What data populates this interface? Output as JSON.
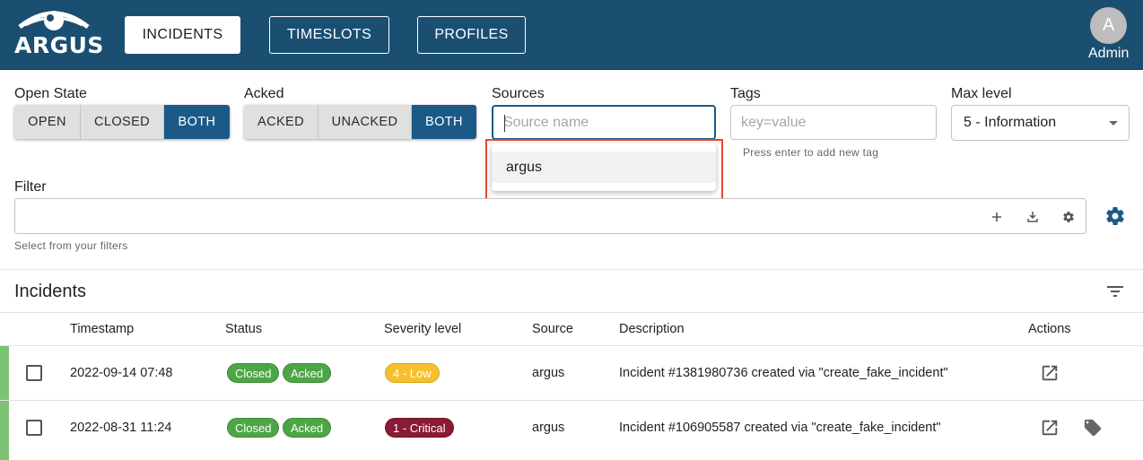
{
  "header": {
    "logo_text": "ARGUS",
    "nav": [
      {
        "label": "INCIDENTS",
        "active": true
      },
      {
        "label": "TIMESLOTS",
        "active": false
      },
      {
        "label": "PROFILES",
        "active": false
      }
    ],
    "user_initial": "A",
    "user_name": "Admin",
    "color": "#1b4f72"
  },
  "filters": {
    "open_state": {
      "label": "Open State",
      "options": [
        "OPEN",
        "CLOSED",
        "BOTH"
      ],
      "selected": "BOTH"
    },
    "acked": {
      "label": "Acked",
      "options": [
        "ACKED",
        "UNACKED",
        "BOTH"
      ],
      "selected": "BOTH"
    },
    "sources": {
      "label": "Sources",
      "placeholder": "Source name",
      "suggestions": [
        "argus"
      ]
    },
    "tags": {
      "label": "Tags",
      "placeholder": "key=value",
      "helper": "Press enter to add new tag"
    },
    "max_level": {
      "label": "Max level",
      "value": "5 - Information"
    },
    "filter": {
      "label": "Filter",
      "helper": "Select from your filters",
      "icons": [
        "add-icon",
        "download-icon",
        "settings-icon"
      ]
    }
  },
  "incidents": {
    "title": "Incidents",
    "columns": [
      "Timestamp",
      "Status",
      "Severity level",
      "Source",
      "Description",
      "Actions"
    ],
    "rows": [
      {
        "timestamp": "2022-09-14 07:48",
        "status": [
          "Closed",
          "Acked"
        ],
        "severity": "4 - Low",
        "source": "argus",
        "description": "Incident #1381980736 created via \"create_fake_incident\"",
        "actions": [
          "open-in-new-icon"
        ]
      },
      {
        "timestamp": "2022-08-31 11:24",
        "status": [
          "Closed",
          "Acked"
        ],
        "severity": "1 - Critical",
        "source": "argus",
        "description": "Incident #106905587 created via \"create_fake_incident\"",
        "actions": [
          "open-in-new-icon",
          "tag-icon"
        ]
      }
    ]
  },
  "colors": {
    "accent": "#1b5a87",
    "highlight_box": "#e8452c",
    "status_green": "#4da646",
    "severity_low": "#f5c02c",
    "severity_critical": "#8b1a35",
    "row_stripe": "#7cc275"
  }
}
